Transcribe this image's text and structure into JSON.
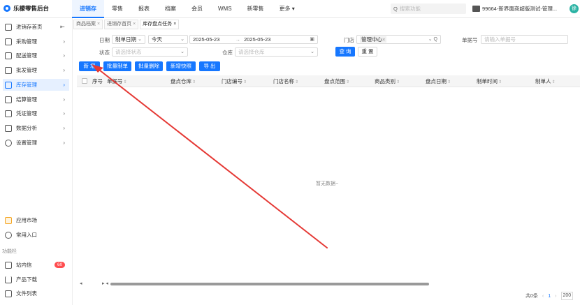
{
  "app": {
    "title": "乐檬零售后台"
  },
  "topnav": {
    "items": [
      "进销存",
      "零售",
      "报表",
      "档案",
      "会员",
      "WMS",
      "新零售",
      "更多"
    ],
    "active_index": 0
  },
  "top_search": {
    "icon": "Q",
    "placeholder": "搜索功能"
  },
  "top_store": {
    "label": "99664-新界面商超版测试-管理..."
  },
  "user": {
    "avatar_text": "徐"
  },
  "sidebar": {
    "items": [
      {
        "label": "进销存首页",
        "icon": "home-icon"
      },
      {
        "label": "采购管理",
        "icon": "cart-icon"
      },
      {
        "label": "配送管理",
        "icon": "truck-icon"
      },
      {
        "label": "批发管理",
        "icon": "wholesale-icon"
      },
      {
        "label": "库存管理",
        "icon": "inventory-icon",
        "active": true
      },
      {
        "label": "结算管理",
        "icon": "settlement-icon"
      },
      {
        "label": "凭证管理",
        "icon": "voucher-icon"
      },
      {
        "label": "数据分析",
        "icon": "chart-icon"
      },
      {
        "label": "设置管理",
        "icon": "settings-icon"
      }
    ],
    "bottom": {
      "app_market": "应用市场",
      "common_entry": "常用入口",
      "section_label": "功能栏",
      "messages": "站内信",
      "messages_badge": "60",
      "downloads": "产品下载",
      "file_list": "文件列表"
    }
  },
  "page_tabs": [
    {
      "label": "商品档案",
      "close": "×"
    },
    {
      "label": "进销存首页",
      "close": "×"
    },
    {
      "label": "库存盘点任务",
      "close": "×",
      "active": true
    }
  ],
  "filters": {
    "date_label": "日期",
    "date_type": "制单日期",
    "date_range": "今天",
    "date_from": "2025-05-23",
    "date_sep": "→",
    "date_to": "2025-05-23",
    "store_label": "门店",
    "store_value": "管理中心",
    "store_tag_close": "×",
    "order_no_label": "单据号",
    "order_no_placeholder": "请输入单据号",
    "status_label": "状态",
    "status_placeholder": "请选择状态",
    "warehouse_label": "仓库",
    "warehouse_placeholder": "请选择仓库",
    "query_button": "查 询",
    "reset_button": "重 置"
  },
  "actions": {
    "new": "新 增",
    "batch_create": "批量制单",
    "batch_delete": "批量删除",
    "quick_new": "新增快照",
    "export": "导 出"
  },
  "table": {
    "columns": [
      "序号",
      "单据号",
      "盘点仓库",
      "门店编号",
      "门店名称",
      "盘点范围",
      "商品类别",
      "盘点日期",
      "制单时间",
      "制单人"
    ],
    "empty_text": "暂无数据~"
  },
  "pagination": {
    "total": "共0条",
    "current": "1",
    "page_size": "200"
  },
  "colors": {
    "accent": "#1677ff",
    "annotation_arrow": "#e53935"
  }
}
